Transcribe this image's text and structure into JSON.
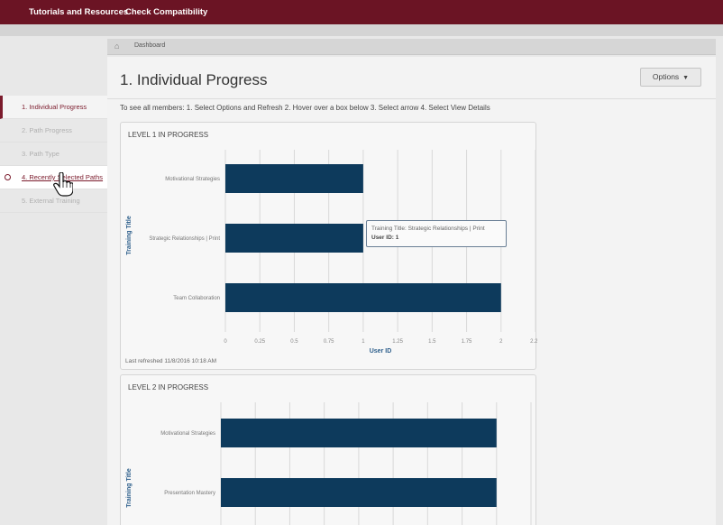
{
  "topbar": {
    "items": [
      "Tutorials and Resources",
      "Check Compatibility"
    ]
  },
  "breadcrumb": {
    "home_icon": "home-icon",
    "item": "Dashboard"
  },
  "sidebar": {
    "items": [
      {
        "label": "1. Individual Progress",
        "state": "active"
      },
      {
        "label": "2. Path Progress",
        "state": "muted"
      },
      {
        "label": "3. Path Type",
        "state": "muted"
      },
      {
        "label": "4. Recently Selected Paths",
        "state": "hover"
      },
      {
        "label": "5. External Training",
        "state": "muted"
      }
    ]
  },
  "page": {
    "title": "1. Individual Progress",
    "options_label": "Options",
    "instructions": "To see all members: 1. Select Options and Refresh 2. Hover over a box below 3. Select arrow 4. Select View Details"
  },
  "colors": {
    "brand": "#6b1424",
    "bar": "#0d3a5c"
  },
  "chart_data": [
    {
      "type": "bar",
      "orientation": "horizontal",
      "title": "LEVEL 1 IN PROGRESS",
      "categories": [
        "Motivational Strategies",
        "Strategic Relationships | Print",
        "Team Collaboration"
      ],
      "values": [
        1,
        1,
        2
      ],
      "xlabel": "User ID",
      "ylabel": "Training Title",
      "xlim": [
        0,
        2.25
      ],
      "xticks": [
        "0",
        "0.25",
        "0.5",
        "0.75",
        "1",
        "1.25",
        "1.5",
        "1.75",
        "2",
        "2.25"
      ],
      "grid": true,
      "footer": "Last refreshed 11/8/2016 10:18 AM",
      "tooltip": {
        "line1": "Training Title: Strategic Relationships | Print",
        "line2": "User ID: 1"
      }
    },
    {
      "type": "bar",
      "orientation": "horizontal",
      "title": "LEVEL 2 IN PROGRESS",
      "categories": [
        "Motivational Strategies",
        "Presentation Mastery"
      ],
      "values": [
        2,
        2
      ],
      "ylabel": "Training Title",
      "xlim": [
        0,
        2.25
      ],
      "grid": true
    }
  ]
}
